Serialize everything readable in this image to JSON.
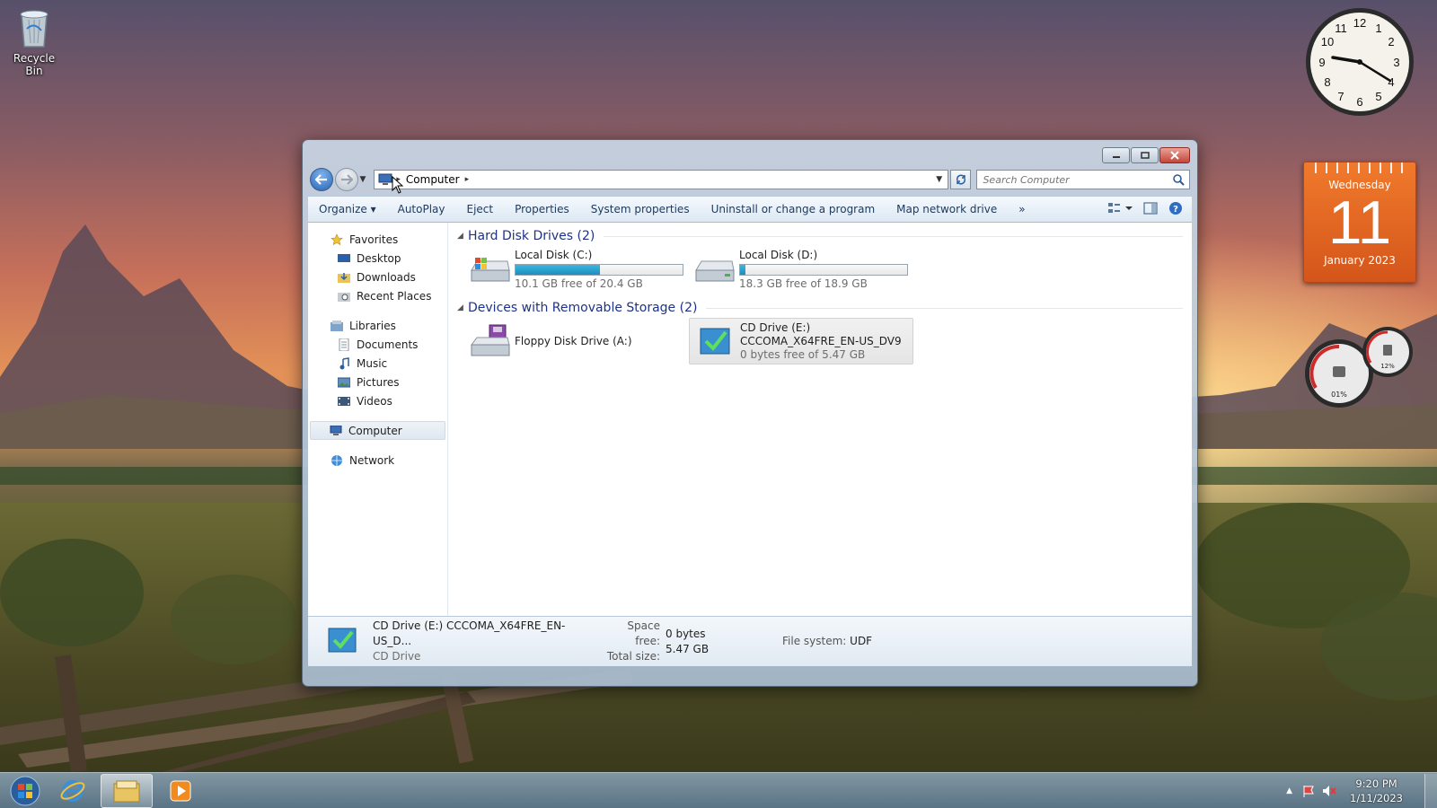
{
  "desktop": {
    "recycle_bin_label": "Recycle Bin"
  },
  "gadgets": {
    "calendar": {
      "day_of_week": "Wednesday",
      "day": "11",
      "month_year": "January 2023"
    },
    "meter": {
      "cpu_label": "01%",
      "ram_label": "12%"
    }
  },
  "window": {
    "breadcrumb": {
      "segment": "Computer"
    },
    "search": {
      "placeholder": "Search Computer"
    },
    "toolbar": {
      "organize": "Organize",
      "autoplay": "AutoPlay",
      "eject": "Eject",
      "properties": "Properties",
      "system_properties": "System properties",
      "uninstall": "Uninstall or change a program",
      "map_network": "Map network drive",
      "more": "»"
    },
    "sidebar": {
      "favorites": "Favorites",
      "desktop": "Desktop",
      "downloads": "Downloads",
      "recent_places": "Recent Places",
      "libraries": "Libraries",
      "documents": "Documents",
      "music": "Music",
      "pictures": "Pictures",
      "videos": "Videos",
      "computer": "Computer",
      "network": "Network"
    },
    "groups": {
      "hard_disks": "Hard Disk Drives (2)",
      "removable": "Devices with Removable Storage (2)"
    },
    "drives": {
      "c": {
        "name": "Local Disk (C:)",
        "free": "10.1 GB free of 20.4 GB",
        "used_fraction": 0.505
      },
      "d": {
        "name": "Local Disk (D:)",
        "free": "18.3 GB free of 18.9 GB",
        "used_fraction": 0.032
      },
      "a": {
        "name": "Floppy Disk Drive (A:)"
      },
      "e": {
        "name": "CD Drive (E:)",
        "label": "CCCOMA_X64FRE_EN-US_DV9",
        "free": "0 bytes free of 5.47 GB"
      }
    },
    "details": {
      "title": "CD Drive (E:) CCCOMA_X64FRE_EN-US_D...",
      "type": "CD Drive",
      "space_free_label": "Space free:",
      "space_free_value": "0 bytes",
      "total_size_label": "Total size:",
      "total_size_value": "5.47 GB",
      "fs_label": "File system:",
      "fs_value": "UDF"
    }
  },
  "taskbar": {
    "time": "9:20 PM",
    "date": "1/11/2023"
  },
  "colors": {
    "accent": "#1e3287",
    "bar_fill": "#1d8dc0",
    "calendar": "#e2651f"
  }
}
